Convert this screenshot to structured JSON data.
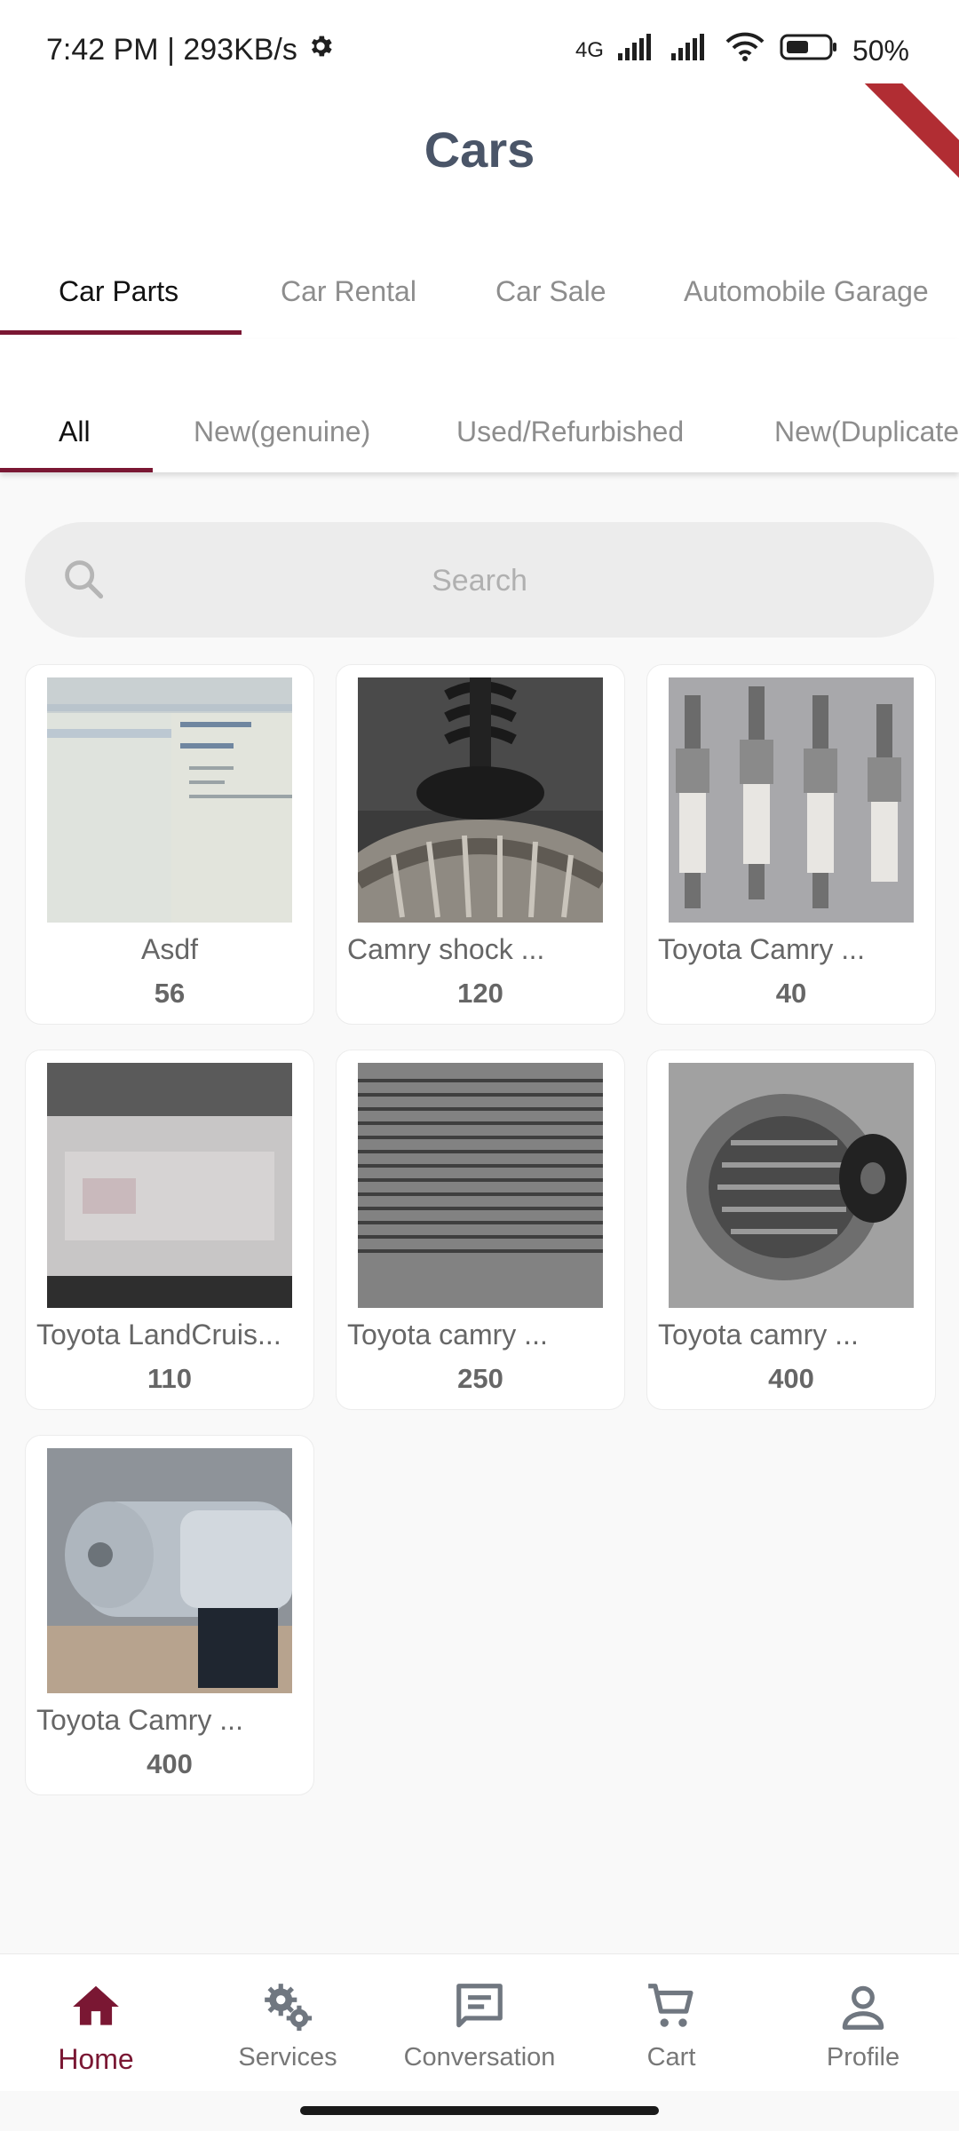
{
  "status": {
    "time_speed": "7:42 PM | 293KB/s",
    "network": "4G",
    "battery": "50%"
  },
  "header": {
    "title": "Cars"
  },
  "category_tabs": [
    {
      "label": "Car Parts",
      "active": true
    },
    {
      "label": "Car Rental",
      "active": false
    },
    {
      "label": "Car Sale",
      "active": false
    },
    {
      "label": "Automobile Garage",
      "active": false
    }
  ],
  "condition_tabs": [
    {
      "label": "All",
      "active": true
    },
    {
      "label": "New(genuine)",
      "active": false
    },
    {
      "label": "Used/Refurbished",
      "active": false
    },
    {
      "label": "New(Duplicate",
      "active": false
    }
  ],
  "search": {
    "placeholder": "Search"
  },
  "products": [
    {
      "name": "Asdf",
      "price": "56"
    },
    {
      "name": "Camry shock ...",
      "price": "120"
    },
    {
      "name": "Toyota Camry ...",
      "price": "40"
    },
    {
      "name": "Toyota LandCruis...",
      "price": "110"
    },
    {
      "name": "Toyota camry ...",
      "price": "250"
    },
    {
      "name": "Toyota camry ...",
      "price": "400"
    },
    {
      "name": "Toyota Camry ...",
      "price": "400"
    }
  ],
  "bottom_nav": [
    {
      "label": "Home",
      "icon": "home-icon",
      "active": true
    },
    {
      "label": "Services",
      "icon": "gears-icon",
      "active": false
    },
    {
      "label": "Conversation",
      "icon": "chat-icon",
      "active": false
    },
    {
      "label": "Cart",
      "icon": "cart-icon",
      "active": false
    },
    {
      "label": "Profile",
      "icon": "person-icon",
      "active": false
    }
  ],
  "colors": {
    "accent": "#7a1733",
    "title": "#4a5568",
    "inactive_tab": "#8d8d8d"
  }
}
